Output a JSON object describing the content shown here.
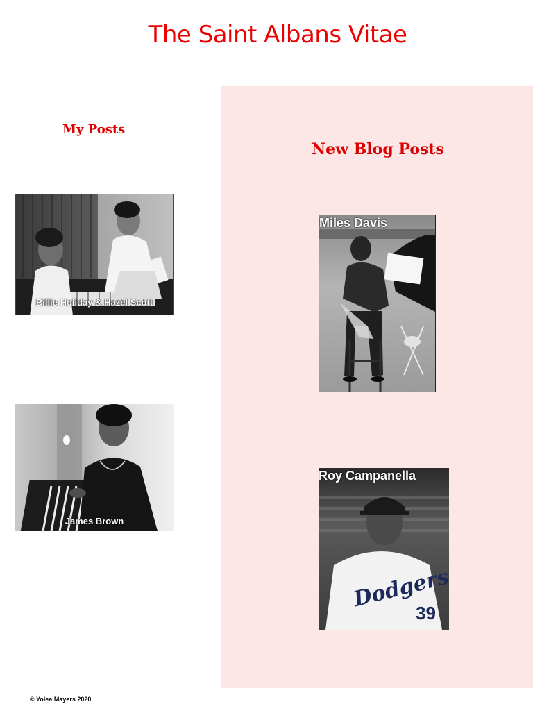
{
  "site": {
    "title": "The Saint Albans Vitae",
    "accent_color": "#ee0000",
    "panel_color": "#fde6e6"
  },
  "my_posts": {
    "heading": "My Posts",
    "items": [
      {
        "caption": "Billie Holiday & Hazel Scott",
        "image": "piano-duo-photo"
      },
      {
        "caption": "James Brown",
        "image": "singer-portrait-photo"
      }
    ]
  },
  "new_blog_posts": {
    "heading": "New Blog Posts",
    "items": [
      {
        "caption": "Miles Davis",
        "image": "trumpeter-seated-photo"
      },
      {
        "caption": "Roy Campanella",
        "image": "baseball-player-photo"
      }
    ]
  },
  "footer": {
    "copyright": "© Yolea Mayers 2020"
  }
}
